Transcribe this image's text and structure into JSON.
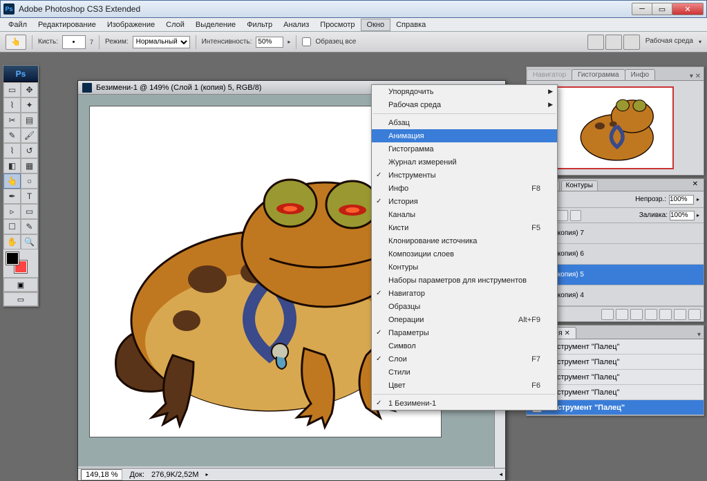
{
  "app": {
    "title": "Adobe Photoshop CS3 Extended",
    "logo": "Ps"
  },
  "menubar": {
    "items": [
      "Файл",
      "Редактирование",
      "Изображение",
      "Слой",
      "Выделение",
      "Фильтр",
      "Анализ",
      "Просмотр",
      "Окно",
      "Справка"
    ],
    "active_index": 8
  },
  "optionsbar": {
    "brush_label": "Кисть:",
    "brush_size": "7",
    "mode_label": "Режим:",
    "mode_value": "Нормальный",
    "intensity_label": "Интенсивность:",
    "intensity_value": "50%",
    "sample_label": "Образец все",
    "workspace_label": "Рабочая среда"
  },
  "document": {
    "title": "Безимени-1 @ 149% (Слой 1 (копия) 5, RGB/8)",
    "zoom": "149,18 %",
    "docsize_label": "Док:",
    "docsize": "276,9K/2,52M"
  },
  "dropdown": {
    "items": [
      {
        "label": "Упорядочить",
        "arrow": true
      },
      {
        "label": "Рабочая среда",
        "arrow": true
      },
      {
        "sep": true
      },
      {
        "label": "Абзац"
      },
      {
        "label": "Анимация",
        "highlighted": true
      },
      {
        "label": "Гистограмма"
      },
      {
        "label": "Журнал измерений"
      },
      {
        "label": "Инструменты",
        "check": true
      },
      {
        "label": "Инфо",
        "shortcut": "F8"
      },
      {
        "label": "История",
        "check": true
      },
      {
        "label": "Каналы"
      },
      {
        "label": "Кисти",
        "shortcut": "F5"
      },
      {
        "label": "Клонирование источника"
      },
      {
        "label": "Композиции слоев"
      },
      {
        "label": "Контуры"
      },
      {
        "label": "Наборы параметров для инструментов"
      },
      {
        "label": "Навигатор",
        "check": true
      },
      {
        "label": "Образцы"
      },
      {
        "label": "Операции",
        "shortcut": "Alt+F9"
      },
      {
        "label": "Параметры",
        "check": true
      },
      {
        "label": "Символ"
      },
      {
        "label": "Слои",
        "shortcut": "F7",
        "check": true
      },
      {
        "label": "Стили"
      },
      {
        "label": "Цвет",
        "shortcut": "F6"
      },
      {
        "sep": true
      },
      {
        "label": "1 Безимени-1",
        "check": true
      }
    ]
  },
  "panels": {
    "nav": {
      "tabs": [
        "Навигатор",
        "Гистограмма",
        "Инфо"
      ],
      "active": 0
    },
    "channels": {
      "tabs": [
        "аналы",
        "Контуры"
      ],
      "opacity_label": "Непрозр.:",
      "opacity_value": "100%",
      "fill_label": "Заливка:",
      "fill_value": "100%"
    },
    "layers": {
      "items": [
        "Слой 1 (копия) 7",
        "Слой 1 (копия) 6",
        "Слой 1 (копия) 5",
        "Слой 1 (копия) 4"
      ],
      "selected_index": 2
    },
    "history": {
      "tab": "История",
      "items": [
        "Инструмент \"Палец\"",
        "Инструмент \"Палец\"",
        "Инструмент \"Палец\"",
        "Инструмент \"Палец\"",
        "Инструмент \"Палец\""
      ],
      "selected_index": 4
    }
  },
  "colors": {
    "foreground": "#000000",
    "background": "#ef3a2a"
  }
}
